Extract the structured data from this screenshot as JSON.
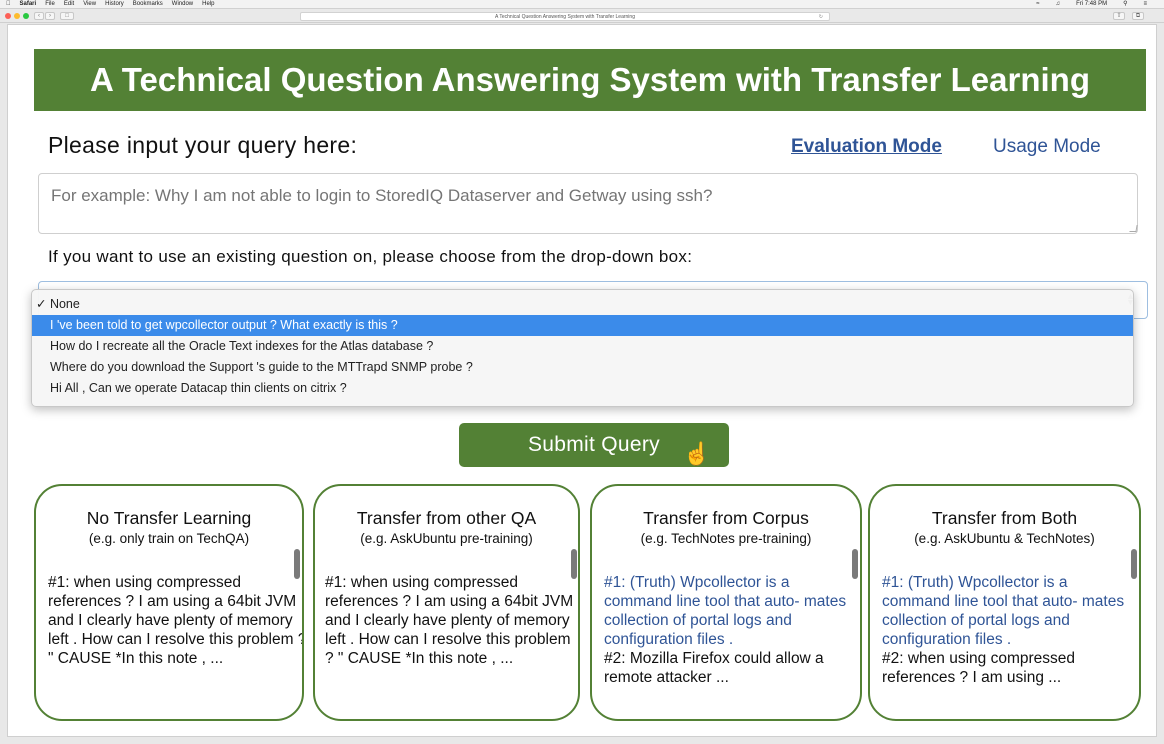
{
  "menubar": {
    "app": "Safari",
    "items": [
      "File",
      "Edit",
      "View",
      "History",
      "Bookmarks",
      "Window",
      "Help"
    ],
    "clock": "Fri 7:48 PM"
  },
  "browser": {
    "url_text": "A Technical Question Answering System with Transfer Learning"
  },
  "header": {
    "title": "A Technical Question Answering System with Transfer Learning"
  },
  "prompt": {
    "label": "Please input your query here:"
  },
  "modes": {
    "evaluation": "Evaluation Mode",
    "usage": "Usage Mode"
  },
  "query": {
    "placeholder": "For example: Why I am not able to login to StoredIQ Dataserver and Getway using ssh?"
  },
  "dropdown": {
    "label": "If you want to use an existing question on, please choose from the drop-down box:",
    "options": [
      "✓ None",
      "I 've been told to get wpcollector output ? What exactly is this ?",
      "How do I recreate all the Oracle Text indexes for the Atlas database ?",
      "Where do you download the Support 's guide to the MTTrapd SNMP probe ?",
      "Hi All , Can we operate Datacap thin clients on citrix ?"
    ]
  },
  "submit": {
    "label": "Submit Query"
  },
  "cards": [
    {
      "title": "No Transfer Learning",
      "subtitle": "(e.g. only train on TechQA)",
      "truth": "",
      "text": "#1: when using compressed references ? I am using a 64bit JVM and I clearly have plenty of memory left . How can I resolve this problem ? \" CAUSE *In this note , ..."
    },
    {
      "title": "Transfer from other QA",
      "subtitle": "(e.g. AskUbuntu pre-training)",
      "truth": "",
      "text": "#1: when using compressed references ? I am using a 64bit JVM and I clearly have plenty of memory left . How can I resolve this problem ? \" CAUSE *In this note , ..."
    },
    {
      "title": "Transfer from Corpus",
      "subtitle": "(e.g. TechNotes pre-training)",
      "truth": "#1: (Truth) Wpcollector is a command line tool that auto- mates collection of portal logs and configuration files .",
      "text": "#2: Mozilla Firefox could allow a remote attacker ..."
    },
    {
      "title": "Transfer from Both",
      "subtitle": "(e.g. AskUbuntu & TechNotes)",
      "truth": "#1: (Truth) Wpcollector is a command line tool that auto- mates collection of portal logs and configuration files .",
      "text": "#2: when using compressed references ? I am using ..."
    }
  ],
  "colors": {
    "accent_green": "#538135",
    "link_blue": "#2f5496",
    "selected_option": "#3b8bea"
  }
}
